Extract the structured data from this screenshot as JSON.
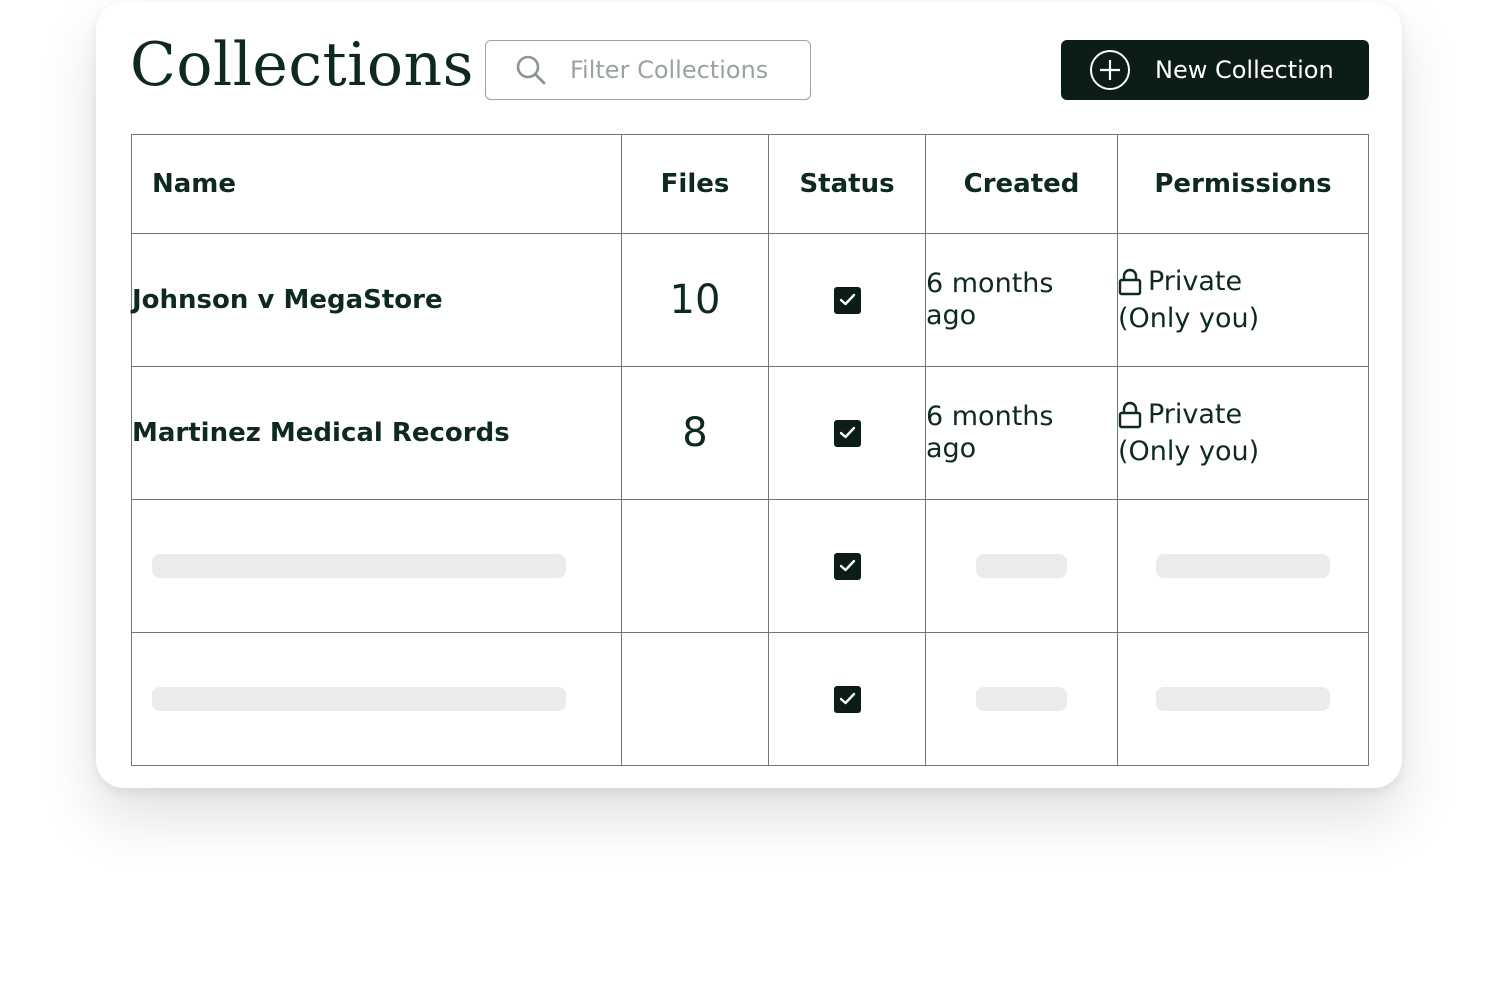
{
  "page": {
    "title": "Collections"
  },
  "search": {
    "placeholder": "Filter Collections",
    "icon": "search-icon"
  },
  "new_collection_button": {
    "label": "New Collection",
    "icon": "plus-circle-icon"
  },
  "table": {
    "columns": [
      "Name",
      "Files",
      "Status",
      "Created",
      "Permissions"
    ],
    "rows": [
      {
        "name": "Johnson v MegaStore",
        "files": "10",
        "status_checked": true,
        "created_line1": "6 months",
        "created_line2": "ago",
        "permission_line1": "Private",
        "permission_line2": "(Only you)"
      },
      {
        "name": "Martinez Medical Records",
        "files": "8",
        "status_checked": true,
        "created_line1": "6 months",
        "created_line2": "ago",
        "permission_line1": "Private",
        "permission_line2": "(Only you)"
      }
    ],
    "loading_rows": 2
  },
  "colors": {
    "text": "#0e2a20",
    "button_bg": "#0c1c16",
    "border": "#6f7a76",
    "skeleton": "#ebebeb"
  }
}
